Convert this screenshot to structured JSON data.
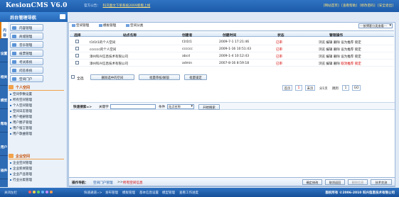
{
  "header": {
    "logo": "KesionCMS V6.0",
    "site_label": "官方公告：",
    "announcement": "科汛图文下单系统2009新版上线",
    "links": [
      "[网站首页]",
      "[查看帮助]",
      "[修改密码]",
      "[安全退出]"
    ],
    "greeting": "欢迎您"
  },
  "sidebar": {
    "title": "后台管理导航",
    "tabs": [
      "内容",
      "设置",
      "相关",
      "模型",
      "帮助",
      "用户",
      "插件"
    ],
    "menu_buttons": [
      "内容管理",
      "商城管理",
      "音乐管理",
      "投票管理",
      "考试系统",
      "问答系统",
      "空间门户"
    ],
    "group1_title": "个人空间",
    "group1_items": [
      "空间参数设置",
      "所有空间管理",
      "个人空间管理",
      "空间日志管理",
      "用户相册管理",
      "用户圈子管理",
      "用户留言管理",
      "用户歌曲管理"
    ],
    "group2_title": "企业空间",
    "group2_items": [
      "企业空间管理",
      "企业新闻管理",
      "企业产品管理",
      "行业分类管理"
    ]
  },
  "toolbar": {
    "items": [
      "空间管理",
      "模板管理",
      "空间分类"
    ],
    "filter": "---按博客分类查看---"
  },
  "table": {
    "headers": [
      "选择",
      "站点名称",
      "创建者",
      "创建时间",
      "状态",
      "管理操作"
    ],
    "rows": [
      {
        "name": "t1t1t1的个人空间",
        "creator": "t1t1t1",
        "time": "2009-7-1 17:21:46",
        "status": "已审",
        "ops": "浏览 编辑 删除 设为推荐 锁定",
        "ops_red": ""
      },
      {
        "name": "cccccc的个人空间",
        "creator": "cccccc",
        "time": "2009-1-16 10:51:43",
        "status": "已审",
        "ops": "浏览 编辑 删除 设为推荐 锁定",
        "ops_red": ""
      },
      {
        "name": "漳州科兴信息技术有限公司",
        "creator": "abcd",
        "time": "2009-1-4 10:12:43",
        "status": "已审",
        "ops": "浏览 编辑 删除 设为推荐 锁定",
        "ops_red": ""
      },
      {
        "name": "漳州科兴信息技术有限公司",
        "creator": "admin",
        "time": "2007-8-16 8:59:18",
        "status": "已审",
        "ops": "浏览 编辑 删除 ",
        "ops_red": "取消推荐 锁定"
      }
    ]
  },
  "actions": {
    "select_all": "全选",
    "delete": "删除选中的空间",
    "batch_review": "批量审核/解锁",
    "batch_lock": "批量锁定"
  },
  "pager": {
    "first": "首页",
    "prev": "1",
    "last": "末页",
    "summary": "分1页",
    "jump": "跳到",
    "page_value": "1",
    "go": "GO"
  },
  "search": {
    "label": "快速搜索=>",
    "keyword": "关键字",
    "condition": "条件",
    "condition_value": "站点名称",
    "button": "开始搜索"
  },
  "bottom": {
    "nav_label": "操作导航：",
    "crumb1": "空间门户管理",
    "sep": ">>",
    "crumb2": "所有空间信息",
    "buttons": [
      "确定修改",
      "取消返回",
      "删除信息",
      "技术交流"
    ]
  },
  "statusbar": {
    "left": "关闭左栏",
    "shortcuts_label": "快速通道=>",
    "shortcuts": [
      "发布管理",
      "模板管理",
      "基本信息设置",
      "模型管理",
      "查看工作进度"
    ],
    "copyright": "版权所有 ©2006-2010 科兴信息技术有限公司"
  }
}
